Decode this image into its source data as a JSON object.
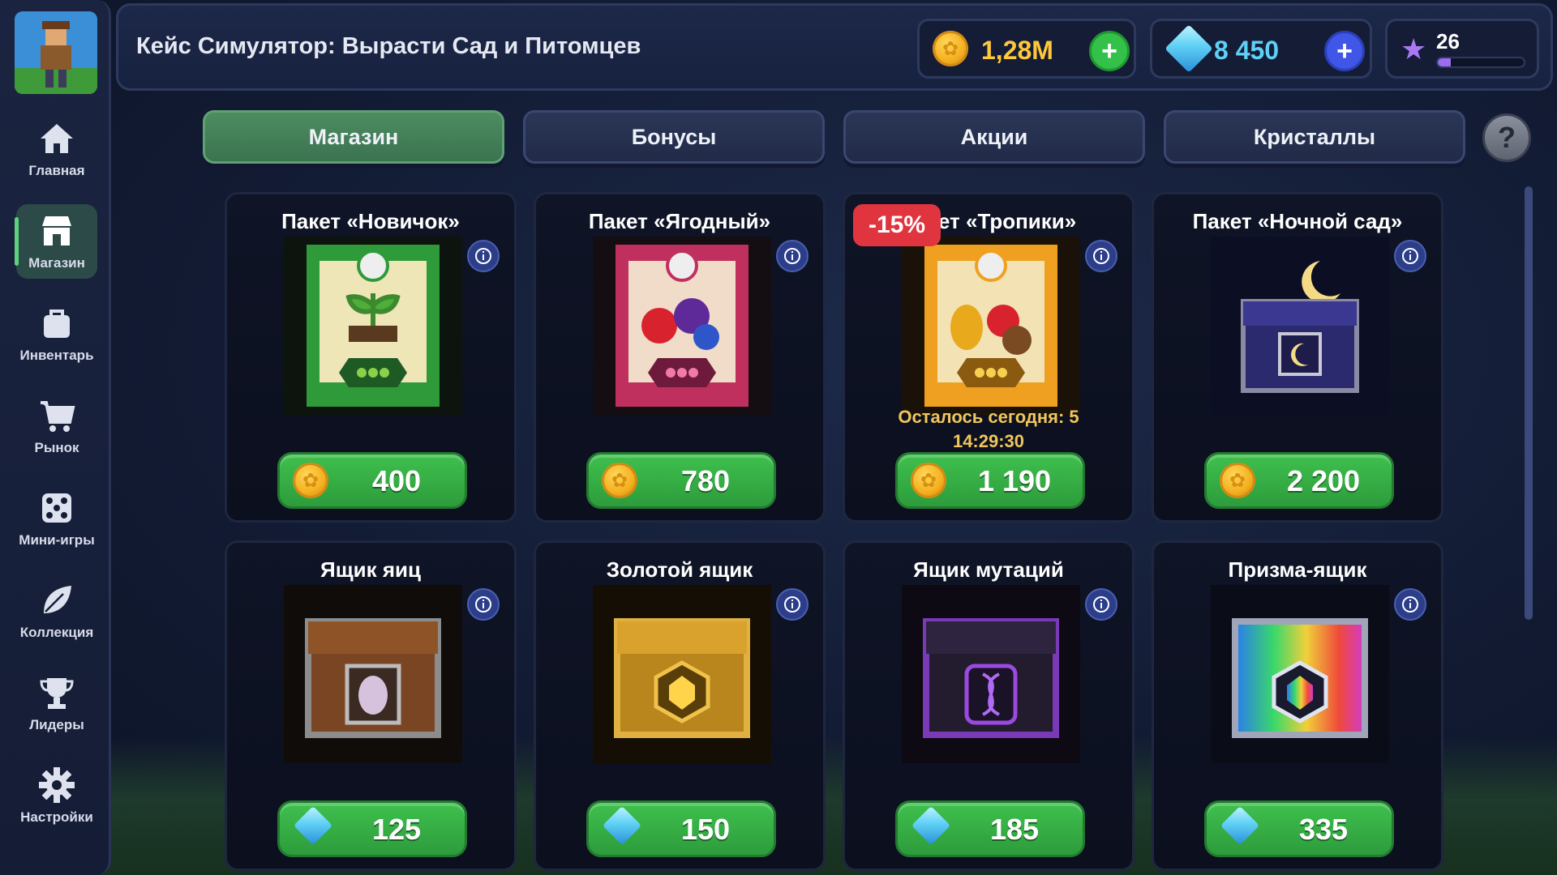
{
  "header": {
    "title": "Кейс Симулятор: Вырасти Сад и Питомцев",
    "coins": "1,28M",
    "gems": "8 450",
    "level": "26",
    "level_progress": 0.15
  },
  "sidebar": {
    "items": [
      {
        "label": "Главная",
        "icon": "home-icon"
      },
      {
        "label": "Магазин",
        "icon": "shop-icon",
        "active": true
      },
      {
        "label": "Инвентарь",
        "icon": "bag-icon"
      },
      {
        "label": "Рынок",
        "icon": "cart-icon"
      },
      {
        "label": "Мини-игры",
        "icon": "dice-icon"
      },
      {
        "label": "Коллекция",
        "icon": "leaf-icon"
      },
      {
        "label": "Лидеры",
        "icon": "trophy-icon"
      },
      {
        "label": "Настройки",
        "icon": "gear-icon"
      }
    ]
  },
  "tabs": [
    {
      "label": "Магазин",
      "active": true
    },
    {
      "label": "Бонусы"
    },
    {
      "label": "Акции"
    },
    {
      "label": "Кристаллы"
    }
  ],
  "help_label": "?",
  "cards": [
    {
      "title": "Пакет «Новичок»",
      "price": "400",
      "currency": "coin",
      "art": "green-seed-pack"
    },
    {
      "title": "Пакет «Ягодный»",
      "price": "780",
      "currency": "coin",
      "art": "berry-seed-pack"
    },
    {
      "title": "Пакет «Тропики»",
      "price": "1 190",
      "currency": "coin",
      "art": "tropical-seed-pack",
      "discount": "-15%",
      "remaining": "Осталось сегодня: 5",
      "timer": "14:29:30"
    },
    {
      "title": "Пакет «Ночной сад»",
      "price": "2 200",
      "currency": "coin",
      "art": "night-garden-chest"
    },
    {
      "title": "Ящик яиц",
      "price": "125",
      "currency": "gem",
      "art": "egg-chest"
    },
    {
      "title": "Золотой ящик",
      "price": "150",
      "currency": "gem",
      "art": "golden-chest"
    },
    {
      "title": "Ящик мутаций",
      "price": "185",
      "currency": "gem",
      "art": "mutation-chest"
    },
    {
      "title": "Призма-ящик",
      "price": "335",
      "currency": "gem",
      "art": "prism-chest"
    }
  ],
  "colors": {
    "accent_green": "#3fc04e",
    "tab_active": "#4d8c61",
    "discount_red": "#e0353f",
    "promo_gold": "#f1c65a",
    "gem_blue": "#5fd0f5"
  }
}
